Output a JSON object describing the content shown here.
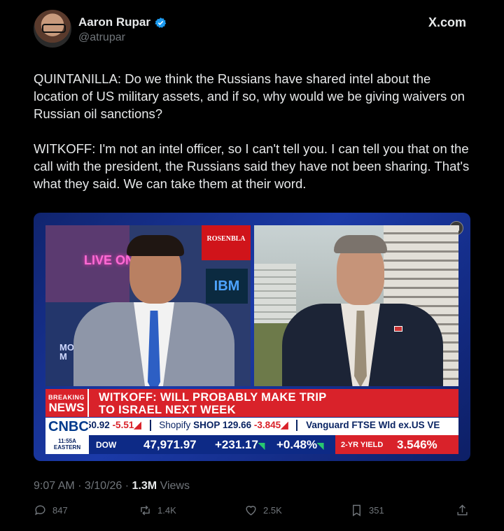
{
  "author": {
    "name": "Aaron Rupar",
    "handle": "@atrupar",
    "verified": true,
    "source_label": "X.com"
  },
  "tweet": {
    "paragraph1": "QUINTANILLA: Do we think the Russians have shared intel about the location of US military assets, and if so, why would we be giving waivers on Russian oil sanctions?",
    "paragraph2": "WITKOFF: I'm not an intel officer, so I can't tell you. I can tell you that on the call with the president, the Russians said they have not been sharing. That's what they said. We can take them at their word."
  },
  "media": {
    "left_screen_live": "LIVE ON",
    "left_screen_rosen": "ROSENBLA",
    "left_screen_ibm": "IBM",
    "left_screen_mo": "MO\nM",
    "breaking_label_top": "BREAKING",
    "breaking_label_bottom": "NEWS",
    "headline_line1": "WITKOFF: WILL PROBABLY MAKE TRIP",
    "headline_line2": "TO ISRAEL NEXT WEEK",
    "network": "CNBC",
    "ticker_item1_value": "50.92",
    "ticker_item1_change": "-5.51",
    "ticker_item2_name": "Shopify",
    "ticker_item2_symbol": "SHOP",
    "ticker_item2_value": "129.66",
    "ticker_item2_change": "-3.845",
    "ticker_item3": "Vanguard FTSE Wld ex.US VE",
    "time": "11:55A",
    "timezone": "EASTERN",
    "index_label": "DOW",
    "index_value": "47,971.97",
    "index_change": "+231.17",
    "index_pct": "+0.48%",
    "yield_label": "2-YR YIELD",
    "yield_value": "3.546%"
  },
  "meta": {
    "time": "9:07 AM",
    "date": "3/10/26",
    "views_count": "1.3M",
    "views_label": "Views"
  },
  "actions": {
    "replies": "847",
    "reposts": "1.4K",
    "likes": "2.5K",
    "bookmarks": "351"
  },
  "colors": {
    "background": "#000000",
    "text": "#e7e9ea",
    "muted": "#71767b",
    "verified": "#1d9bf0",
    "breaking_red": "#d9222a",
    "cnbc_blue": "#0d2a86"
  }
}
